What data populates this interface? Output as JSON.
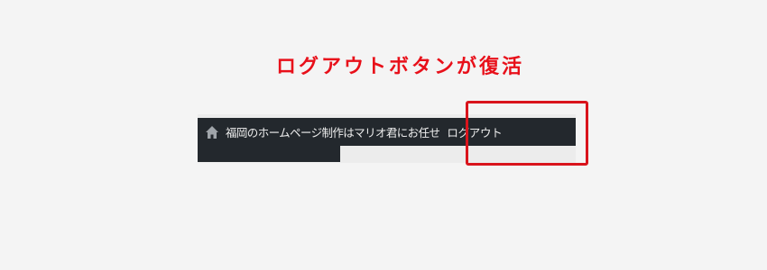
{
  "annotation": {
    "title": "ログアウトボタンが復活",
    "highlight_color": "#d9141c",
    "title_color": "#e8101a"
  },
  "adminbar": {
    "site_icon": "home-icon",
    "site_name": "福岡のホームページ制作はマリオ君にお任せ",
    "logout_label": "ログアウト",
    "background": "#23282d"
  }
}
